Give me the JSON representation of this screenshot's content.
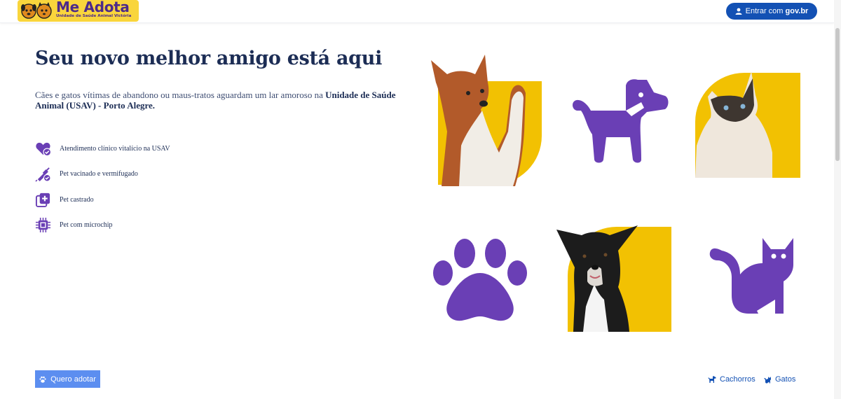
{
  "header": {
    "logo_title": "Me Adota",
    "logo_subtitle": "Unidade de Saúde Animal Victória",
    "login_prefix": "Entrar com ",
    "login_brand": "gov.br"
  },
  "hero": {
    "title": "Seu novo melhor amigo está aqui",
    "intro_text": "Cães e gatos vítimas de abandono ou maus-tratos aguardam um lar amoroso na ",
    "intro_bold": "Unidade de Saúde Animal (USAV) - Porto Alegre."
  },
  "features": [
    {
      "label": "Atendimento clínico vitalício na USAV",
      "icon": "heart-check-icon"
    },
    {
      "label": "Pet vacinado e vermifugado",
      "icon": "syringe-check-icon"
    },
    {
      "label": "Pet castrado",
      "icon": "medical-plus-icon"
    },
    {
      "label": "Pet com microchip",
      "icon": "microchip-icon"
    }
  ],
  "actions": {
    "adopt_label": "Quero adotar",
    "dogs_label": "Cachorros",
    "cats_label": "Gatos"
  },
  "colors": {
    "brand_purple": "#6a3fb5",
    "brand_yellow": "#f2c102",
    "gov_blue": "#1351b4",
    "adopt_blue": "#5c8ef0",
    "title_navy": "#1c2d55"
  }
}
